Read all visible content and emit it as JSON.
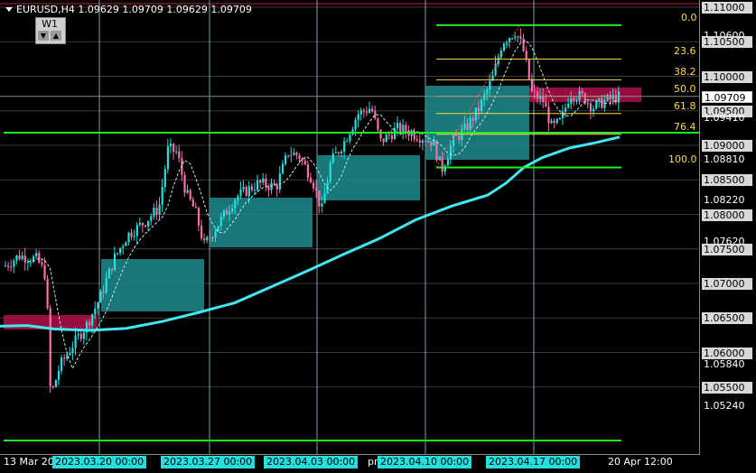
{
  "header": {
    "symbol_line": "EURUSD,H4  1.09629 1.09709 1.09629 1.09709",
    "timeframe_label": "W1",
    "btn_down": "▼",
    "btn_up": "▲"
  },
  "price_axis": {
    "labels": [
      {
        "text": "1.11000",
        "style": "boxed",
        "price": 1.11
      },
      {
        "text": "1.10600",
        "style": "plain",
        "price": 1.106
      },
      {
        "text": "1.10500",
        "style": "boxed",
        "price": 1.105
      },
      {
        "text": "1.10000",
        "style": "boxed",
        "price": 1.1
      },
      {
        "text": "1.09709",
        "style": "current",
        "price": 1.09709
      },
      {
        "text": "1.09500",
        "style": "boxed",
        "price": 1.095
      },
      {
        "text": "1.09410",
        "style": "plain",
        "price": 1.0941
      },
      {
        "text": "1.09000",
        "style": "boxed",
        "price": 1.09
      },
      {
        "text": "1.08810",
        "style": "plain",
        "price": 1.0881
      },
      {
        "text": "1.08500",
        "style": "boxed",
        "price": 1.085
      },
      {
        "text": "1.08220",
        "style": "plain",
        "price": 1.0822
      },
      {
        "text": "1.08000",
        "style": "boxed",
        "price": 1.08
      },
      {
        "text": "1.07620",
        "style": "plain",
        "price": 1.0762
      },
      {
        "text": "1.07500",
        "style": "boxed",
        "price": 1.075
      },
      {
        "text": "1.07000",
        "style": "boxed",
        "price": 1.07
      },
      {
        "text": "1.06500",
        "style": "boxed",
        "price": 1.065
      },
      {
        "text": "1.06000",
        "style": "boxed",
        "price": 1.06
      },
      {
        "text": "1.05840",
        "style": "plain",
        "price": 1.0584
      },
      {
        "text": "1.05500",
        "style": "boxed",
        "price": 1.055
      },
      {
        "text": "1.05240",
        "style": "plain",
        "price": 1.0524
      }
    ]
  },
  "time_axis": {
    "labels": [
      {
        "text": "13 Mar 20",
        "style": "plain"
      },
      {
        "text": "2023.03.20 00:00",
        "style": "box"
      },
      {
        "text": "2023.03.27 00:00",
        "style": "box"
      },
      {
        "text": "2023.04.03 00:00",
        "style": "box"
      },
      {
        "text": "pr",
        "style": "plain"
      },
      {
        "text": "2023.04.10 00:00",
        "style": "box"
      },
      {
        "text": "2023.04.17 00:00",
        "style": "box"
      },
      {
        "text": "20 Apr 12:00",
        "style": "plain"
      }
    ]
  },
  "fib_levels": [
    {
      "label": "0.0",
      "price": 1.1074
    },
    {
      "label": "23.6",
      "price": 1.1025
    },
    {
      "label": "38.2",
      "price": 1.0995
    },
    {
      "label": "50.0",
      "price": 1.0971
    },
    {
      "label": "61.8",
      "price": 1.0946
    },
    {
      "label": "76.4",
      "price": 1.0916
    },
    {
      "label": "100.0",
      "price": 1.0868
    }
  ],
  "colors": {
    "background": "#000000",
    "bull": "#26e0e0",
    "bear": "#ff6fa8",
    "fib": "#ffd84a",
    "green_line": "#22ee22",
    "ma": "#40e8f0",
    "zone_teal": "#1d8c8c",
    "zone_red": "#b0104a"
  }
}
